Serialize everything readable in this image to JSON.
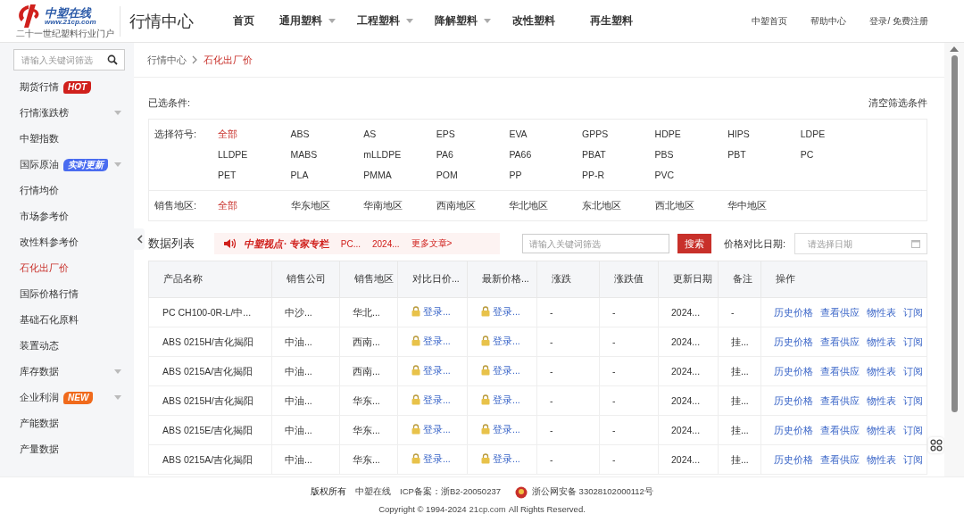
{
  "header": {
    "logo": {
      "name": "中塑在线",
      "url": "www.21cp.com",
      "tagline": "二十一世纪塑料行业门户"
    },
    "title": "行情中心",
    "nav": [
      {
        "label": "首页",
        "dropdown": false
      },
      {
        "label": "通用塑料",
        "dropdown": true
      },
      {
        "label": "工程塑料",
        "dropdown": true
      },
      {
        "label": "降解塑料",
        "dropdown": true
      },
      {
        "label": "改性塑料",
        "dropdown": false
      },
      {
        "label": "再生塑料",
        "dropdown": false
      }
    ],
    "links": [
      "中塑首页",
      "帮助中心",
      "登录/ 免费注册"
    ]
  },
  "sidebar": {
    "search": {
      "placeholder": "请输入关键词筛选"
    },
    "items": [
      {
        "label": "期货行情",
        "badge": {
          "text": "HOT",
          "color": "#d0201c"
        },
        "expandable": false,
        "selected": false
      },
      {
        "label": "行情涨跌榜",
        "expandable": true,
        "selected": false
      },
      {
        "label": "中塑指数",
        "expandable": false,
        "selected": false
      },
      {
        "label": "国际原油",
        "badge": {
          "text": "实时更新",
          "color": "#4a6cf0"
        },
        "expandable": true,
        "selected": false
      },
      {
        "label": "行情均价",
        "expandable": false,
        "selected": false
      },
      {
        "label": "市场参考价",
        "expandable": false,
        "selected": false
      },
      {
        "label": "改性料参考价",
        "expandable": false,
        "selected": false
      },
      {
        "label": "石化出厂价",
        "expandable": false,
        "selected": true
      },
      {
        "label": "国际价格行情",
        "expandable": false,
        "selected": false
      },
      {
        "label": "基础石化原料",
        "expandable": false,
        "selected": false
      },
      {
        "label": "装置动态",
        "expandable": false,
        "selected": false
      },
      {
        "label": "库存数据",
        "expandable": true,
        "selected": false
      },
      {
        "label": "企业利润",
        "badge": {
          "text": "NEW",
          "color": "#f06a1c"
        },
        "expandable": true,
        "selected": false
      },
      {
        "label": "产能数据",
        "expandable": false,
        "selected": false
      },
      {
        "label": "产量数据",
        "expandable": false,
        "selected": false
      }
    ]
  },
  "breadcrumb": [
    "行情中心",
    "石化出厂价"
  ],
  "filters": {
    "label": "已选条件:",
    "clear": "清空筛选条件",
    "groups": [
      {
        "label": "选择符号:",
        "options": [
          {
            "label": "全部",
            "selected": true
          },
          {
            "label": "ABS",
            "selected": false
          },
          {
            "label": "AS",
            "selected": false
          },
          {
            "label": "EPS",
            "selected": false
          },
          {
            "label": "EVA",
            "selected": false
          },
          {
            "label": "GPPS",
            "selected": false
          },
          {
            "label": "HDPE",
            "selected": false
          },
          {
            "label": "HIPS",
            "selected": false
          },
          {
            "label": "LDPE",
            "selected": false
          },
          {
            "label": "LLDPE",
            "selected": false
          },
          {
            "label": "MABS",
            "selected": false
          },
          {
            "label": "mLLDPE",
            "selected": false
          },
          {
            "label": "PA6",
            "selected": false
          },
          {
            "label": "PA66",
            "selected": false
          },
          {
            "label": "PBAT",
            "selected": false
          },
          {
            "label": "PBS",
            "selected": false
          },
          {
            "label": "PBT",
            "selected": false
          },
          {
            "label": "PC",
            "selected": false
          },
          {
            "label": "PET",
            "selected": false
          },
          {
            "label": "PLA",
            "selected": false
          },
          {
            "label": "PMMA",
            "selected": false
          },
          {
            "label": "POM",
            "selected": false
          },
          {
            "label": "PP",
            "selected": false
          },
          {
            "label": "PP-R",
            "selected": false
          },
          {
            "label": "PVC",
            "selected": false
          }
        ]
      },
      {
        "label": "销售地区:",
        "options": [
          {
            "label": "全部",
            "selected": true
          },
          {
            "label": "华东地区",
            "selected": false
          },
          {
            "label": "华南地区",
            "selected": false
          },
          {
            "label": "西南地区",
            "selected": false
          },
          {
            "label": "华北地区",
            "selected": false
          },
          {
            "label": "东北地区",
            "selected": false
          },
          {
            "label": "西北地区",
            "selected": false
          },
          {
            "label": "华中地区",
            "selected": false
          }
        ]
      }
    ]
  },
  "data_list": {
    "title": "数据列表",
    "banner": {
      "brand": "中塑视点",
      "column": "· 专家专栏",
      "articles": [
        "PC...",
        "2024..."
      ],
      "more": "更多文章>"
    },
    "search": {
      "placeholder": "请输入关键词筛选",
      "button": "搜索"
    },
    "date": {
      "label": "价格对比日期:",
      "placeholder": "请选择日期"
    },
    "table": {
      "columns": [
        "产品名称",
        "销售公司",
        "销售地区",
        "对比日价...",
        "最新价格...",
        "涨跌",
        "涨跌值",
        "更新日期",
        "备注",
        "操作"
      ],
      "rows": [
        {
          "product": "PC CH100-0R-L/中...",
          "company": "中沙...",
          "region": "华北...",
          "compare_price": "登录...",
          "latest_price": "登录...",
          "change": "-",
          "change_value": "-",
          "date": "2024...",
          "remark": "-",
          "actions": [
            "历史价格",
            "查看供应",
            "物性表",
            "订阅"
          ]
        },
        {
          "product": "ABS 0215H/吉化揭阳",
          "company": "中油...",
          "region": "西南...",
          "compare_price": "登录...",
          "latest_price": "登录...",
          "change": "-",
          "change_value": "-",
          "date": "2024...",
          "remark": "挂...",
          "actions": [
            "历史价格",
            "查看供应",
            "物性表",
            "订阅"
          ]
        },
        {
          "product": "ABS 0215A/吉化揭阳",
          "company": "中油...",
          "region": "西南...",
          "compare_price": "登录...",
          "latest_price": "登录...",
          "change": "-",
          "change_value": "-",
          "date": "2024...",
          "remark": "挂...",
          "actions": [
            "历史价格",
            "查看供应",
            "物性表",
            "订阅"
          ]
        },
        {
          "product": "ABS 0215H/吉化揭阳",
          "company": "中油...",
          "region": "华东...",
          "compare_price": "登录...",
          "latest_price": "登录...",
          "change": "-",
          "change_value": "-",
          "date": "2024...",
          "remark": "挂...",
          "actions": [
            "历史价格",
            "查看供应",
            "物性表",
            "订阅"
          ]
        },
        {
          "product": "ABS 0215E/吉化揭阳",
          "company": "中油...",
          "region": "华东...",
          "compare_price": "登录...",
          "latest_price": "登录...",
          "change": "-",
          "change_value": "-",
          "date": "2024...",
          "remark": "挂...",
          "actions": [
            "历史价格",
            "查看供应",
            "物性表",
            "订阅"
          ]
        },
        {
          "product": "ABS 0215A/吉化揭阳",
          "company": "中油...",
          "region": "华东...",
          "compare_price": "登录...",
          "latest_price": "登录...",
          "change": "-",
          "change_value": "-",
          "date": "2024...",
          "remark": "挂...",
          "actions": [
            "历史价格",
            "查看供应",
            "物性表",
            "订阅"
          ]
        }
      ]
    }
  },
  "footer": {
    "items": [
      "版权所有",
      "中塑在线",
      "ICP备案：浙B2-20050237",
      "浙公网安备 33028102000112号"
    ],
    "copyright": "Copyright © 1994-2024",
    "domain": "21cp.com",
    "rights": "All Rights Reserved."
  }
}
